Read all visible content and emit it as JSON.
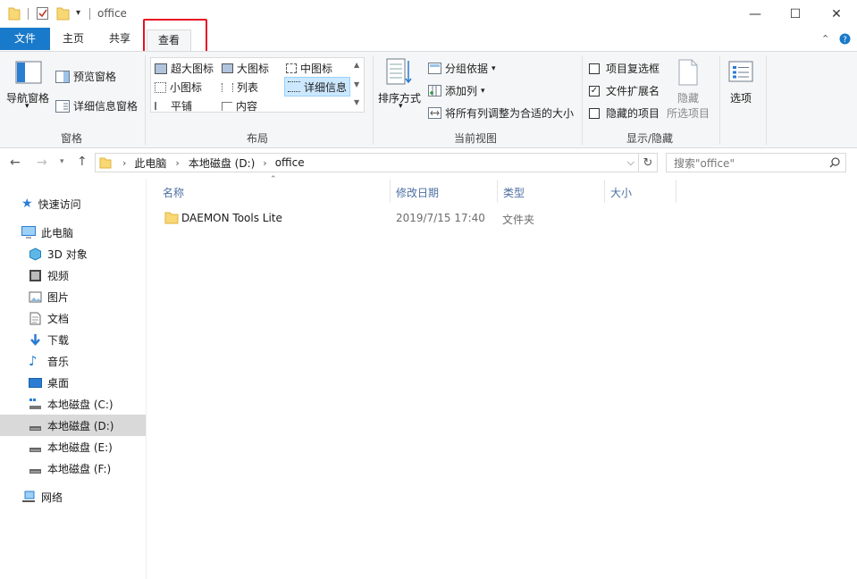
{
  "window": {
    "title": "office"
  },
  "tabs": [
    {
      "label": "文件",
      "active_blue": true
    },
    {
      "label": "主页"
    },
    {
      "label": "共享"
    },
    {
      "label": "查看",
      "selected": true
    }
  ],
  "ribbon": {
    "panes": {
      "nav_pane": "导航窗格",
      "preview_pane": "预览窗格",
      "details_pane": "详细信息窗格",
      "group": "窗格"
    },
    "layout": {
      "items": [
        "超大图标",
        "大图标",
        "中图标",
        "小图标",
        "列表",
        "详细信息",
        "平铺",
        "内容"
      ],
      "selected": "详细信息",
      "group": "布局"
    },
    "current_view": {
      "sort_by": "排序方式",
      "group_by": "分组依据",
      "add_columns": "添加列",
      "size_all_columns": "将所有列调整为合适的大小",
      "group": "当前视图"
    },
    "show_hide": {
      "item_checkboxes": {
        "label": "项目复选框",
        "checked": false
      },
      "file_extensions": {
        "label": "文件扩展名",
        "checked": true
      },
      "hidden_items": {
        "label": "隐藏的项目",
        "checked": false
      },
      "hide_selected": [
        "隐藏",
        "所选项目"
      ],
      "group": "显示/隐藏"
    },
    "options": "选项"
  },
  "address": {
    "crumbs": [
      "此电脑",
      "本地磁盘 (D:)",
      "office"
    ],
    "search_placeholder": "搜索\"office\""
  },
  "sidebar": {
    "quick_access": "快速访问",
    "this_pc": "此电脑",
    "items": [
      {
        "label": "3D 对象",
        "icon": "3d-objects-icon"
      },
      {
        "label": "视频",
        "icon": "video-icon"
      },
      {
        "label": "图片",
        "icon": "pictures-icon"
      },
      {
        "label": "文档",
        "icon": "documents-icon"
      },
      {
        "label": "下载",
        "icon": "download-icon"
      },
      {
        "label": "音乐",
        "icon": "music-icon"
      },
      {
        "label": "桌面",
        "icon": "desktop-icon"
      },
      {
        "label": "本地磁盘 (C:)",
        "icon": "drive-c-icon"
      },
      {
        "label": "本地磁盘 (D:)",
        "icon": "drive-icon",
        "selected": true
      },
      {
        "label": "本地磁盘 (E:)",
        "icon": "drive-icon"
      },
      {
        "label": "本地磁盘 (F:)",
        "icon": "drive-icon"
      }
    ],
    "network": "网络"
  },
  "columns": {
    "name": "名称",
    "modified": "修改日期",
    "type": "类型",
    "size": "大小"
  },
  "files": [
    {
      "name": "DAEMON Tools Lite",
      "modified": "2019/7/15 17:40",
      "type": "文件夹",
      "size": ""
    }
  ],
  "colors": {
    "accent": "#1979ca",
    "highlight_box": "#e81123",
    "selection": "#cce8ff",
    "nav_selected": "#d9d9d9"
  }
}
